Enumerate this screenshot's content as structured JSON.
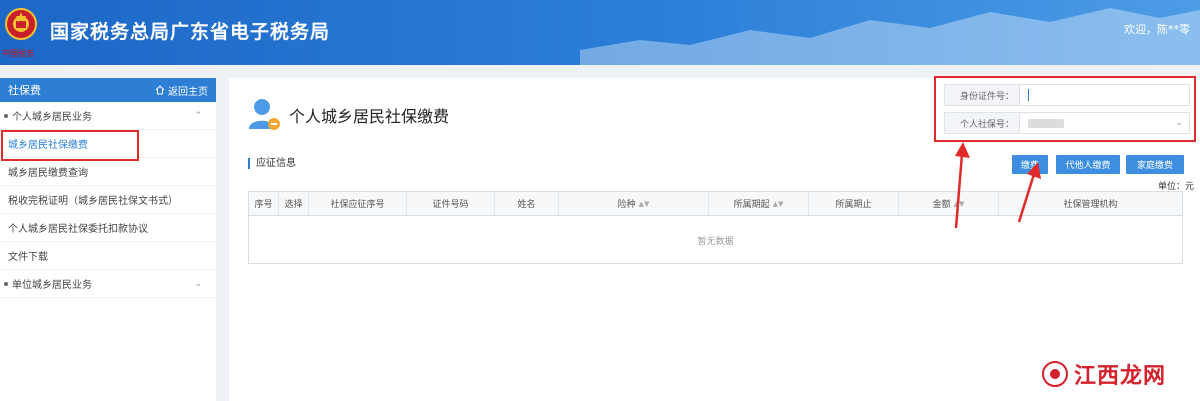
{
  "header": {
    "site_title": "国家税务总局广东省电子税务局",
    "emblem_caption": "中国税务",
    "welcome": "欢迎，陈**零"
  },
  "sidebar": {
    "title": "社保费",
    "home_label": "返回主页",
    "items": [
      {
        "label": "个人城乡居民业务",
        "type": "group"
      },
      {
        "label": "城乡居民社保缴费",
        "type": "active"
      },
      {
        "label": "城乡居民缴费查询",
        "type": "item"
      },
      {
        "label": "税收完税证明（城乡居民社保文书式）",
        "type": "item"
      },
      {
        "label": "个人城乡居民社保委托扣款协议",
        "type": "item"
      },
      {
        "label": "文件下载",
        "type": "item"
      },
      {
        "label": "单位城乡居民业务",
        "type": "group"
      }
    ]
  },
  "page": {
    "title": "个人城乡居民社保缴费",
    "section_label": "应征信息",
    "unit": "单位：元"
  },
  "form": {
    "id_label": "身份证件号：",
    "id_value": "",
    "social_label": "个人社保号：",
    "social_value": ""
  },
  "buttons": {
    "pay": "缴费",
    "proxy_pay": "代他人缴费",
    "family_pay": "家庭缴费"
  },
  "table": {
    "columns": [
      "序号",
      "选择",
      "社保应征序号",
      "证件号码",
      "姓名",
      "险种",
      "所属期起",
      "所属期止",
      "金额",
      "社保管理机构"
    ],
    "empty_text": "暂无数据"
  },
  "watermark": "江西龙网",
  "colors": {
    "header_blue": "#2b7fd8",
    "accent_blue": "#3d8ee0",
    "highlight_red": "#e02b2b"
  }
}
